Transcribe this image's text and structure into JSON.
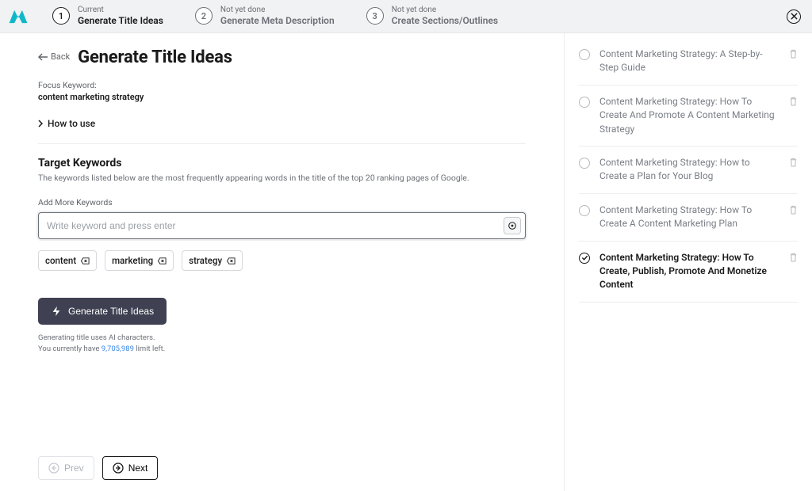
{
  "header": {
    "steps": [
      {
        "num": "1",
        "status": "Current",
        "title": "Generate Title Ideas",
        "active": true
      },
      {
        "num": "2",
        "status": "Not yet done",
        "title": "Generate Meta Description",
        "active": false
      },
      {
        "num": "3",
        "status": "Not yet done",
        "title": "Create Sections/Outlines",
        "active": false
      }
    ]
  },
  "main": {
    "back": "Back",
    "title": "Generate Title Ideas",
    "focus_label": "Focus Keyword:",
    "focus_value": "content marketing strategy",
    "how_to_use": "How to use",
    "target": {
      "heading": "Target Keywords",
      "desc": "The keywords listed below are the most frequently appearing words in the title of the top 20 ranking pages of Google.",
      "add_label": "Add More Keywords",
      "placeholder": "Write keyword and press enter",
      "chips": [
        "content",
        "marketing",
        "strategy"
      ]
    },
    "generate_button": "Generate Title Ideas",
    "fineprint_1": "Generating title uses AI characters.",
    "fineprint_2a": "You currently have ",
    "fineprint_num": "9,705,989",
    "fineprint_2b": " limit left."
  },
  "footer": {
    "prev": "Prev",
    "next": "Next"
  },
  "titles": [
    {
      "text": "Content Marketing Strategy: A Step-by-Step Guide",
      "selected": false
    },
    {
      "text": "Content Marketing Strategy: How To Create And Promote A Content Marketing Strategy",
      "selected": false
    },
    {
      "text": "Content Marketing Strategy: How to Create a Plan for Your Blog",
      "selected": false
    },
    {
      "text": "Content Marketing Strategy: How To Create A Content Marketing Plan",
      "selected": false
    },
    {
      "text": "Content Marketing Strategy: How To Create, Publish, Promote And Monetize Content",
      "selected": true
    }
  ]
}
